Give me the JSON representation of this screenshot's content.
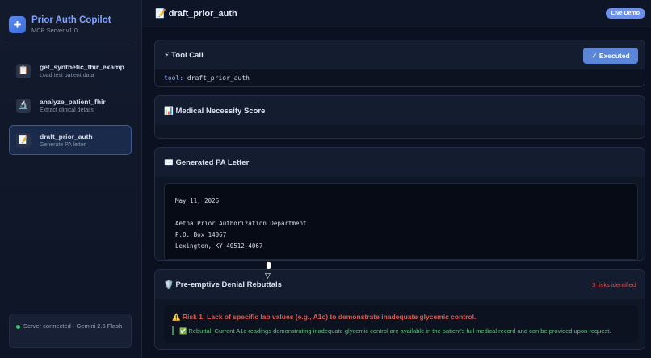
{
  "sidebar": {
    "brand": {
      "title": "Prior Auth Copilot",
      "subtitle": "MCP Server v1.0",
      "logo_icon": "plus-icon"
    },
    "tools": [
      {
        "name": "get_synthetic_fhir_example",
        "desc": "Load test patient data",
        "icon": "clipboard-icon",
        "glyph": "📋"
      },
      {
        "name": "analyze_patient_fhir",
        "desc": "Extract clinical details",
        "icon": "microscope-icon",
        "glyph": "🔬"
      },
      {
        "name": "draft_prior_auth",
        "desc": "Generate PA letter",
        "icon": "memo-icon",
        "glyph": "📝",
        "active": true
      }
    ],
    "status": "Server connected · Gemini 2.5 Flash"
  },
  "topbar": {
    "title": "📝 draft_prior_auth",
    "badge": "Live Demo"
  },
  "tool_call": {
    "title": "⚡ Tool Call",
    "button": "✓ Executed",
    "code_key": "tool:",
    "code_value": " draft_prior_auth"
  },
  "score": {
    "title": "📊 Medical Necessity Score"
  },
  "letter": {
    "title": "✉️ Generated PA Letter",
    "lines": {
      "date": "May 11, 2026",
      "addr1": "Aetna Prior Authorization Department",
      "addr2": "P.O. Box 14067",
      "addr3": "Lexington, KY 40512-4067"
    }
  },
  "rebuttals": {
    "title": "🛡️ Pre-emptive Denial Rebuttals",
    "count": "3 risks identified",
    "risk1": {
      "title": "⚠️ Risk 1: Lack of specific lab values (e.g., A1c) to demonstrate inadequate glycemic control.",
      "rebuttal": "✅ Rebuttal: Current A1c readings demonstrating inadequate glycemic control are available in the patient's full medical record and can be provided upon request."
    }
  },
  "colors": {
    "accent": "#6d8fe8",
    "risk": "#e0584c",
    "success": "#5fc27e",
    "status_dot": "#3fbf6f"
  }
}
